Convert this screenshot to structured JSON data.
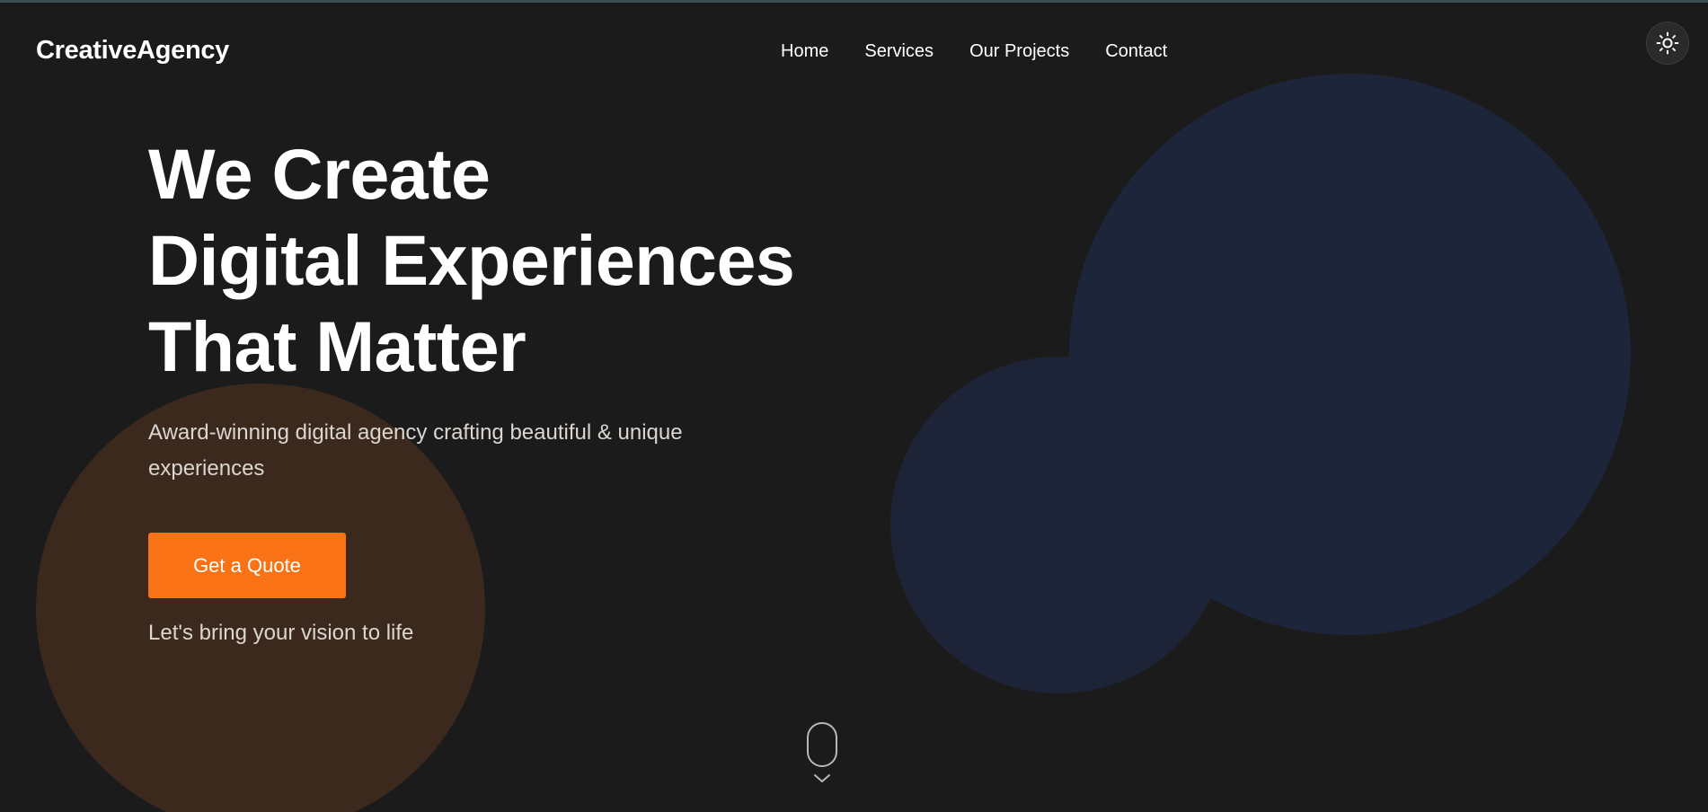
{
  "header": {
    "logo": "CreativeAgency",
    "nav": [
      {
        "label": "Home"
      },
      {
        "label": "Services"
      },
      {
        "label": "Our Projects"
      },
      {
        "label": "Contact"
      }
    ],
    "theme_toggle_icon": "sun-icon"
  },
  "hero": {
    "title_lines": [
      "We Create",
      "Digital Experiences",
      "That Matter"
    ],
    "subtitle": "Award-winning digital agency crafting beautiful & unique experiences",
    "cta_label": "Get a Quote",
    "tagline": "Let's bring your vision to life",
    "scroll_icon": "mouse-scroll-icon"
  },
  "colors": {
    "background": "#1b1b1b",
    "accent": "#f97316",
    "orange_circle": "#3c291d",
    "blue_circle": "#1c253a"
  }
}
